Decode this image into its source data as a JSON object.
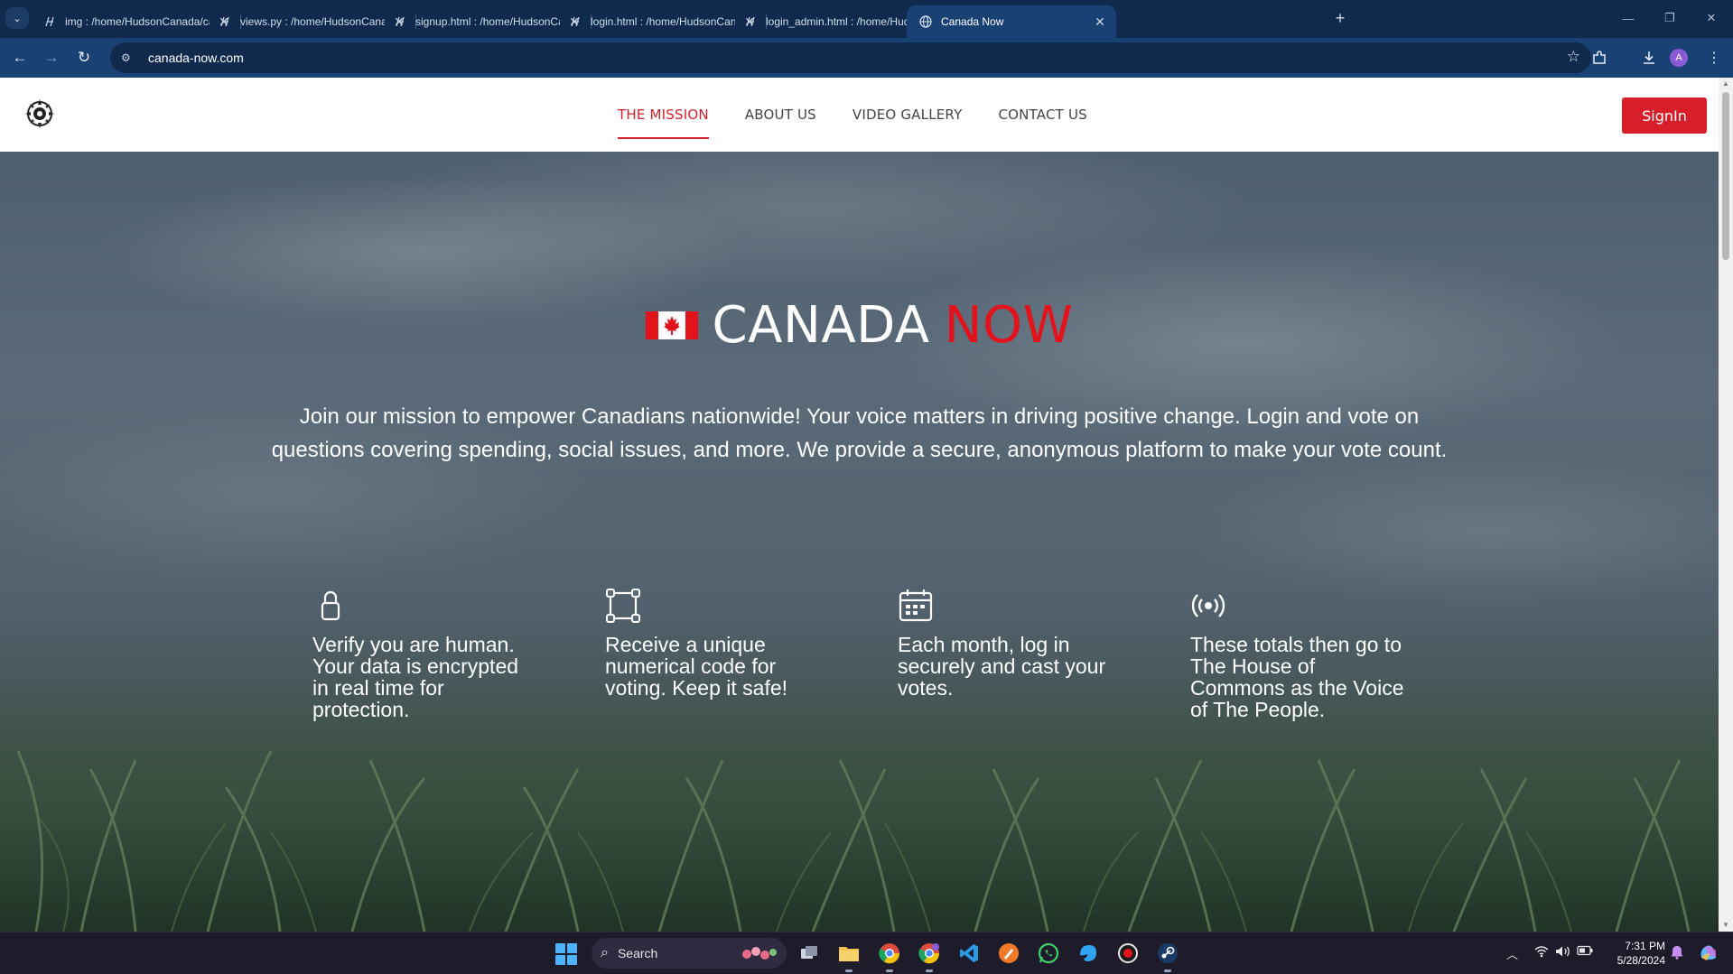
{
  "browser": {
    "tabs": [
      {
        "title": "img : /home/HudsonCanada/ca",
        "active": false
      },
      {
        "title": "views.py : /home/HudsonCanada",
        "active": false
      },
      {
        "title": "signup.html : /home/HudsonCa",
        "active": false
      },
      {
        "title": "login.html : /home/HudsonCan",
        "active": false
      },
      {
        "title": "login_admin.html : /home/Huds",
        "active": false
      },
      {
        "title": "Canada Now",
        "active": true
      }
    ],
    "new_tab_label": "+",
    "url": "canada-now.com",
    "profile_initial": "A"
  },
  "site": {
    "nav": {
      "items": [
        "THE MISSION",
        "ABOUT US",
        "VIDEO GALLERY",
        "CONTACT US"
      ],
      "active_index": 0
    },
    "signin_label": "SignIn",
    "hero": {
      "title_main": "CANADA",
      "title_accent": "NOW",
      "description": "Join our mission to empower Canadians nationwide! Your voice matters in driving positive change. Login and vote on questions covering spending, social issues, and more. We provide a secure, anonymous platform to make your vote count."
    },
    "features": [
      {
        "icon": "lock-icon",
        "text": "Verify you are human. Your data is encrypted in real time for protection."
      },
      {
        "icon": "vector-square-icon",
        "text": "Receive a unique numerical code for voting. Keep it safe!"
      },
      {
        "icon": "calendar-icon",
        "text": "Each month, log in securely and cast your votes."
      },
      {
        "icon": "broadcast-icon",
        "text": "These totals then go to The House of Commons as the Voice of The People."
      }
    ],
    "colors": {
      "accent": "#d81e2a",
      "title_accent": "#e3121b",
      "header_bg": "#ffffff"
    }
  },
  "taskbar": {
    "search_placeholder": "Search",
    "time": "7:31 PM",
    "date": "5/28/2024"
  }
}
